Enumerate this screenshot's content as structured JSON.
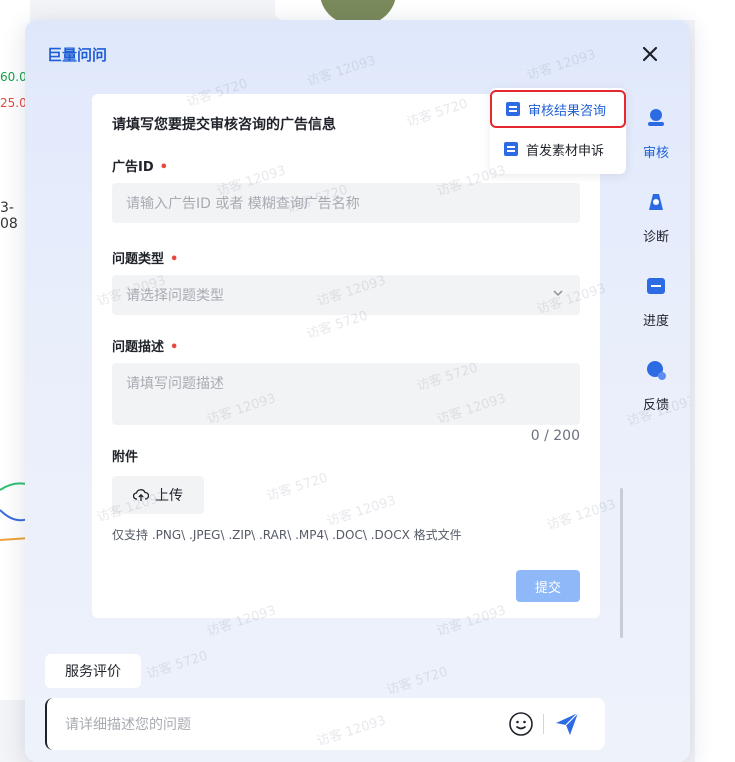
{
  "background": {
    "value_green": "60.0",
    "value_red": "25.0",
    "date_fragment": "3-08"
  },
  "dialog": {
    "title": "巨量问问",
    "close_glyph": "✕"
  },
  "form": {
    "heading": "请填写您要提交审核咨询的广告信息",
    "ad_id": {
      "label": "广告ID",
      "required_mark": "•",
      "placeholder": "请输入广告ID 或者 模糊查询广告名称"
    },
    "issue_type": {
      "label": "问题类型",
      "required_mark": "•",
      "placeholder": "请选择问题类型"
    },
    "issue_desc": {
      "label": "问题描述",
      "required_mark": "•",
      "placeholder": "请填写问题描述",
      "counter": "0 / 200"
    },
    "attachment": {
      "label": "附件",
      "upload_label": "上传",
      "hint": "仅支持 .PNG\\ .JPEG\\ .ZIP\\ .RAR\\ .MP4\\ .DOC\\ .DOCX 格式文件"
    },
    "submit_label": "提交"
  },
  "popup": {
    "items": [
      {
        "label": "审核结果咨询",
        "active": true
      },
      {
        "label": "首发素材申诉",
        "active": false
      }
    ]
  },
  "rail": {
    "items": [
      {
        "label": "审核",
        "icon": "review-icon",
        "active": true
      },
      {
        "label": "诊断",
        "icon": "diagnose-icon",
        "active": false
      },
      {
        "label": "进度",
        "icon": "progress-icon",
        "active": false
      },
      {
        "label": "反馈",
        "icon": "feedback-icon",
        "active": false
      }
    ]
  },
  "bottom": {
    "service_eval_label": "服务评价",
    "chat_placeholder": "请详细描述您的问题"
  },
  "watermarks": [
    "访客 12093",
    "访客 5720"
  ],
  "colors": {
    "accent": "#1f5fd6",
    "required": "#e5483f",
    "submit_disabled": "#8fb8f8",
    "highlight_border": "#e5272e"
  }
}
